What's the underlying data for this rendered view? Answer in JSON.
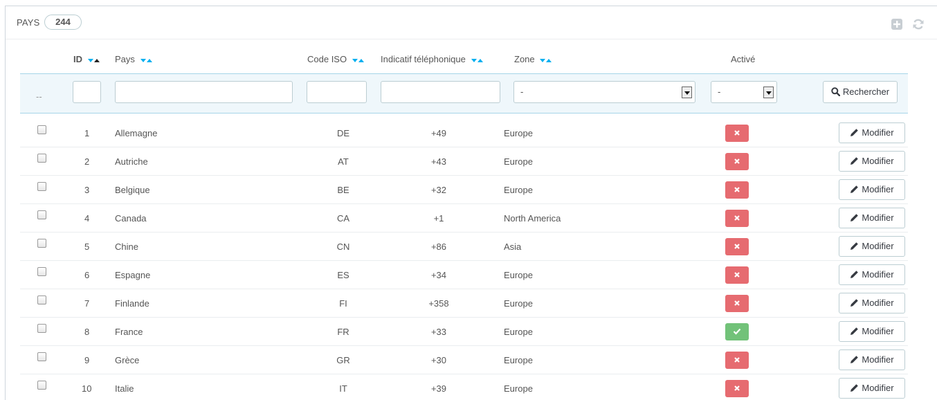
{
  "panel": {
    "title": "PAYS",
    "count": "244"
  },
  "columns": {
    "id": "ID",
    "country": "Pays",
    "iso": "Code ISO",
    "phone": "Indicatif téléphonique",
    "zone": "Zone",
    "active": "Activé"
  },
  "filters": {
    "bulk": "--",
    "zone_value": "-",
    "active_value": "-",
    "search_label": "Rechercher"
  },
  "edit_label": "Modifier",
  "rows": [
    {
      "id": "1",
      "name": "Allemagne",
      "iso": "DE",
      "phone": "+49",
      "zone": "Europe",
      "active": false
    },
    {
      "id": "2",
      "name": "Autriche",
      "iso": "AT",
      "phone": "+43",
      "zone": "Europe",
      "active": false
    },
    {
      "id": "3",
      "name": "Belgique",
      "iso": "BE",
      "phone": "+32",
      "zone": "Europe",
      "active": false
    },
    {
      "id": "4",
      "name": "Canada",
      "iso": "CA",
      "phone": "+1",
      "zone": "North America",
      "active": false
    },
    {
      "id": "5",
      "name": "Chine",
      "iso": "CN",
      "phone": "+86",
      "zone": "Asia",
      "active": false
    },
    {
      "id": "6",
      "name": "Espagne",
      "iso": "ES",
      "phone": "+34",
      "zone": "Europe",
      "active": false
    },
    {
      "id": "7",
      "name": "Finlande",
      "iso": "FI",
      "phone": "+358",
      "zone": "Europe",
      "active": false
    },
    {
      "id": "8",
      "name": "France",
      "iso": "FR",
      "phone": "+33",
      "zone": "Europe",
      "active": true
    },
    {
      "id": "9",
      "name": "Grèce",
      "iso": "GR",
      "phone": "+30",
      "zone": "Europe",
      "active": false
    },
    {
      "id": "10",
      "name": "Italie",
      "iso": "IT",
      "phone": "+39",
      "zone": "Europe",
      "active": false
    }
  ],
  "colors": {
    "accent": "#00aff0",
    "disabled": "#e66b70",
    "enabled": "#72c279"
  }
}
